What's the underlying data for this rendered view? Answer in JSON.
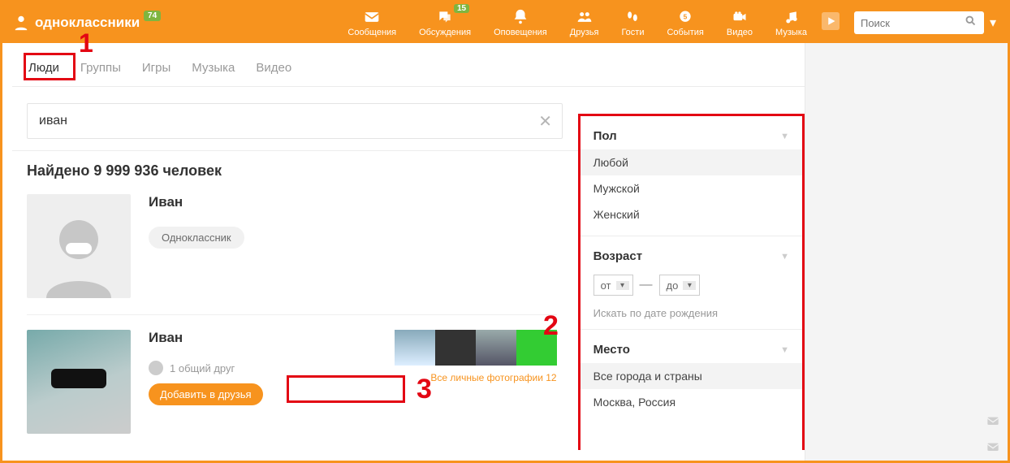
{
  "brand": {
    "name": "одноклассники",
    "badge": "74"
  },
  "topnav": [
    {
      "label": "Сообщения"
    },
    {
      "label": "Обсуждения",
      "badge": "15"
    },
    {
      "label": "Оповещения"
    },
    {
      "label": "Друзья"
    },
    {
      "label": "Гости"
    },
    {
      "label": "События"
    },
    {
      "label": "Видео"
    },
    {
      "label": "Музыка"
    }
  ],
  "top_search_placeholder": "Поиск",
  "tabs": {
    "people": "Люди",
    "groups": "Группы",
    "games": "Игры",
    "music": "Музыка",
    "video": "Видео"
  },
  "search_value": "иван",
  "results_count": "Найдено 9 999 936 человек",
  "annot": {
    "one": "1",
    "two": "2",
    "three": "3"
  },
  "card1": {
    "name": "Иван",
    "chip": "Одноклассник"
  },
  "card2": {
    "name": "Иван",
    "mutual": "1 общий друг",
    "add": "Добавить в друзья",
    "photos_link": "Все личные фотографии 12"
  },
  "filters": {
    "gender": {
      "title": "Пол",
      "any": "Любой",
      "male": "Мужской",
      "female": "Женский"
    },
    "age": {
      "title": "Возраст",
      "from": "от",
      "to": "до",
      "dob": "Искать по дате рождения"
    },
    "place": {
      "title": "Место",
      "all": "Все города и страны",
      "moscow": "Москва, Россия"
    }
  }
}
